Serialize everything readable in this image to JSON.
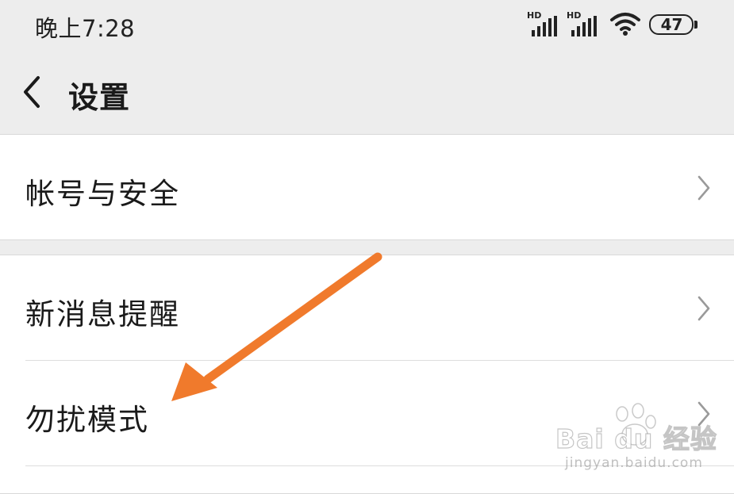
{
  "status_bar": {
    "time": "晚上7:28",
    "signal1_label": "HD",
    "signal2_label": "HD",
    "battery": "47"
  },
  "header": {
    "title": "设置"
  },
  "settings": {
    "account_security": "帐号与安全",
    "new_message_alert": "新消息提醒",
    "do_not_disturb": "勿扰模式"
  },
  "watermark": {
    "brand": "Bai du 经验",
    "url": "jingyan.baidu.com"
  },
  "annotation": {
    "arrow_color": "#f07a2c"
  }
}
